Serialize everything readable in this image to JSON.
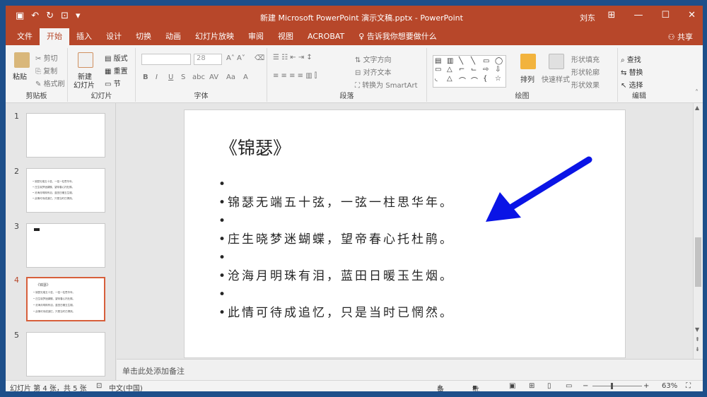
{
  "title_bar": {
    "title": "新建 Microsoft PowerPoint 演示文稿.pptx  -  PowerPoint",
    "user": "刘东",
    "minimize": "—",
    "restore": "☐",
    "close": "✕"
  },
  "tabs": [
    "文件",
    "开始",
    "插入",
    "设计",
    "切换",
    "动画",
    "幻灯片放映",
    "审阅",
    "视图",
    "ACROBAT"
  ],
  "active_tab_index": 1,
  "tell_me": "告诉我你想要做什么",
  "share": "共享",
  "ribbon": {
    "clipboard": {
      "paste": "粘贴",
      "cut": "剪切",
      "copy": "复制",
      "format_painter": "格式刷",
      "label": "剪贴板"
    },
    "slides": {
      "new_slide": "新建",
      "new_slide2": "幻灯片",
      "layout": "版式",
      "reset": "重置",
      "section": "节",
      "label": "幻灯片"
    },
    "font": {
      "size": "28",
      "label": "字体",
      "bold": "B",
      "italic": "I",
      "underline": "U",
      "strike": "S",
      "shadow": "abc",
      "spacing": "AV",
      "case": "Aa",
      "color": "A"
    },
    "paragraph": {
      "text_direction": "文字方向",
      "align_text": "对齐文本",
      "smartart": "转换为 SmartArt",
      "label": "段落"
    },
    "drawing": {
      "arrange": "排列",
      "quick_styles": "快速样式",
      "fill": "形状填充",
      "outline": "形状轮廓",
      "effects": "形状效果",
      "label": "绘图"
    },
    "editing": {
      "find": "查找",
      "replace": "替换",
      "select": "选择",
      "label": "编辑"
    }
  },
  "thumbnails": {
    "numbers": [
      "1",
      "2",
      "3",
      "4",
      "5"
    ],
    "active_index": 3,
    "slide2_lines": [
      "• 锦瑟无端五十弦，一弦一柱思华年。",
      "• 庄生晓梦迷蝴蝶，望帝春心托杜鹃。",
      "• 沧海月明珠有泪，蓝田日暖玉生烟。",
      "• 此情可待成追忆，只是当时已惘然。"
    ],
    "slide4_title": "《锦瑟》",
    "slide4_lines": [
      "• 锦瑟无端五十弦，一弦一柱思华年。",
      "• 庄生晓梦迷蝴蝶，望帝春心托杜鹃。",
      "• 沧海月明珠有泪，蓝田日暖玉生烟。",
      "• 此情可待成追忆，只是当时已惘然。"
    ]
  },
  "slide": {
    "title": "《锦瑟》",
    "lines": [
      "•",
      "•锦瑟无端五十弦，一弦一柱思华年。",
      "•",
      "•庄生晓梦迷蝴蝶，望帝春心托杜鹃。",
      "•",
      "•沧海月明珠有泪，蓝田日暖玉生烟。",
      "•",
      "•此情可待成追忆，只是当时已惘然。"
    ],
    "arrow_color": "#0a14e6"
  },
  "notes_placeholder": "单击此处添加备注",
  "status": {
    "slide_info": "幻灯片 第 4 张，共 5 张",
    "language": "中文(中国)",
    "notes": "备注",
    "comments": "批注",
    "zoom": "63%"
  },
  "colors": {
    "accent": "#b7472a",
    "active_thumb": "#d75f3b"
  }
}
